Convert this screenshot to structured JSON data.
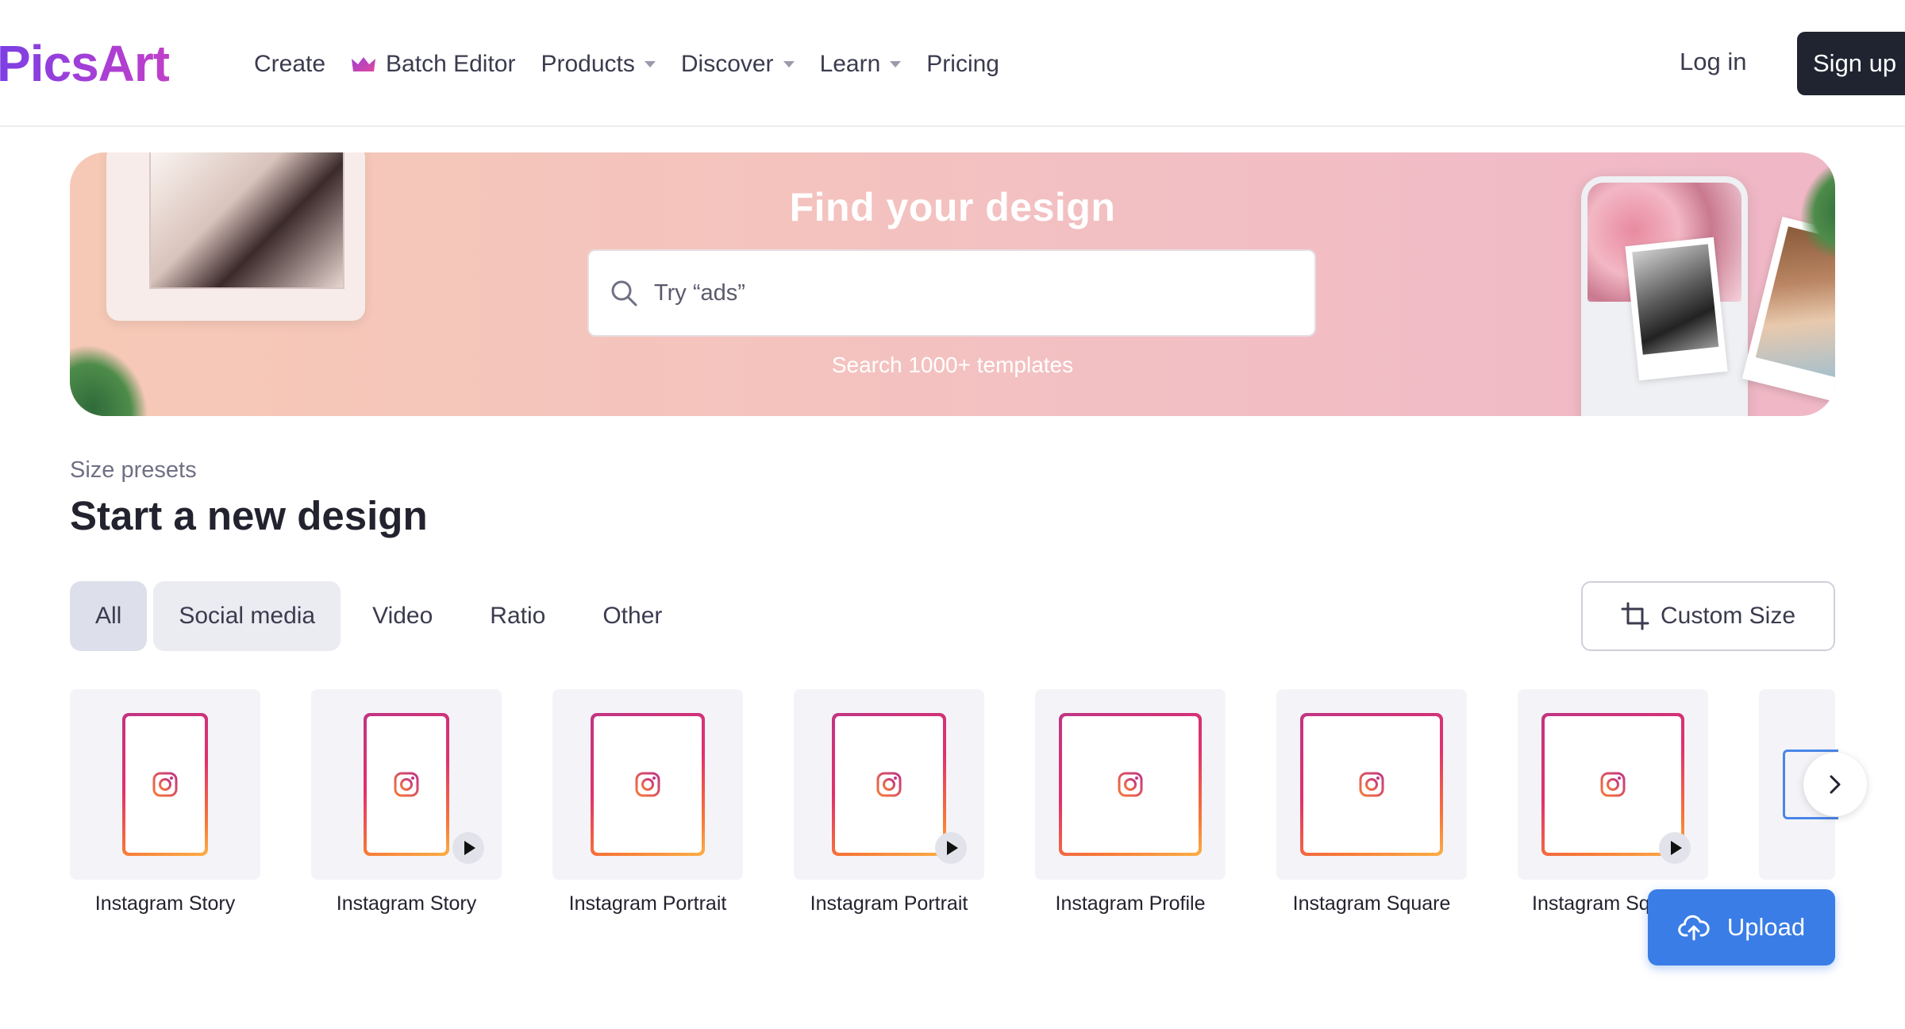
{
  "header": {
    "logo": "PicsArt",
    "nav": {
      "create": "Create",
      "batch_editor": "Batch Editor",
      "products": "Products",
      "discover": "Discover",
      "learn": "Learn",
      "pricing": "Pricing"
    },
    "login": "Log in",
    "signup": "Sign up"
  },
  "banner": {
    "title": "Find your design",
    "search_placeholder": "Try “ads”",
    "subtitle": "Search 1000+ templates"
  },
  "section": {
    "eyebrow": "Size presets",
    "title": "Start a new design"
  },
  "filters": {
    "all": "All",
    "social_media": "Social media",
    "video": "Video",
    "ratio": "Ratio",
    "other": "Other",
    "active": "All"
  },
  "custom_size": "Custom Size",
  "presets": [
    {
      "label": "Instagram Story",
      "video": false
    },
    {
      "label": "Instagram Story",
      "video": true
    },
    {
      "label": "Instagram Portrait",
      "video": false
    },
    {
      "label": "Instagram Portrait",
      "video": true
    },
    {
      "label": "Instagram Profile",
      "video": false
    },
    {
      "label": "Instagram Square",
      "video": false
    },
    {
      "label": "Instagram Sq",
      "video": true
    }
  ],
  "upload": "Upload",
  "colors": {
    "brand_purple": "#7b3fe4",
    "signup_bg": "#1f2430",
    "upload_blue": "#3a7de6",
    "instagram_gradient": [
      "#c13584",
      "#e1306c",
      "#f77737",
      "#fcaf45"
    ]
  }
}
